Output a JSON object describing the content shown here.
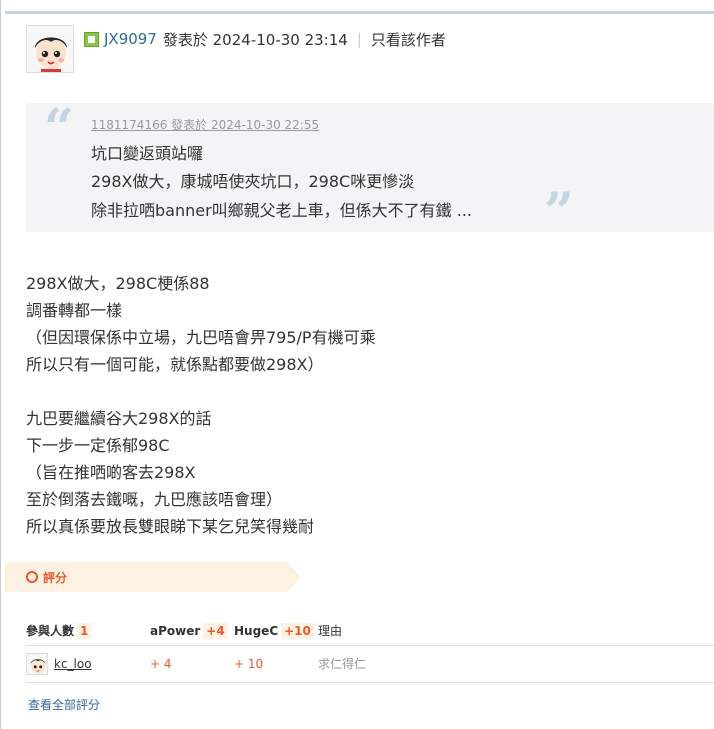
{
  "post": {
    "author": "JX9097",
    "meta": "發表於 2024-10-30 23:14",
    "separator": "|",
    "only_author_label": "只看該作者"
  },
  "quote": {
    "cite": "1181174166 發表於 2024-10-30 22:55",
    "lines": [
      "坑口變返頭站囉",
      "298X做大，康城唔使夾坑口，298C咪更慘淡",
      "除非拉哂banner叫鄉親父老上車，但係大不了有鐵 ..."
    ]
  },
  "body": {
    "lines": [
      "298X做大，298C梗係88",
      "調番轉都一樣",
      "（但因環保係中立場，九巴唔會畀795/P有機可乘",
      "所以只有一個可能，就係點都要做298X）",
      "",
      "九巴要繼續谷大298X的話",
      "下一步一定係郁98C",
      "（旨在推哂啲客去298X",
      "至於倒落去鐵嘅，九巴應該唔會理）",
      "所以真係要放長雙眼睇下某乞兒笑得幾耐"
    ]
  },
  "rating": {
    "title": "評分",
    "participants_label": "參與人數",
    "participants_count": "1",
    "col_apower": "aPower",
    "col_apower_total": "+4",
    "col_hugec": "HugeC",
    "col_hugec_total": "+10",
    "col_reason": "理由",
    "rows": [
      {
        "user": "kc_loo",
        "apower": "+ 4",
        "hugec": "+ 10",
        "reason": "求仁得仁"
      }
    ],
    "view_all": "查看全部評分"
  },
  "colors": {
    "link": "#336699",
    "accent_orange": "#e85a2e",
    "quote_bg": "#f3f4f6",
    "quote_mark": "#c3d4e4",
    "rate_tab_bg": "#fdf1e2",
    "top_border": "#c2d5e3"
  },
  "icons": {
    "avatar": "cartoon-avatar",
    "online": "online-status-icon",
    "rate": "circle-icon"
  }
}
